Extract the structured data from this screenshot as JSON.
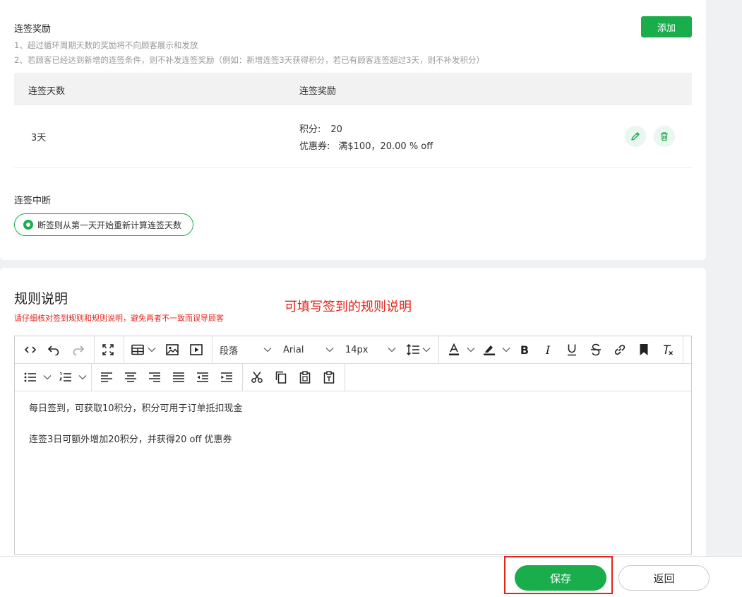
{
  "streak_reward": {
    "title": "连签奖励",
    "notes": [
      "1、超过循环周期天数的奖励将不向顾客展示和发放",
      "2、若顾客已经达到新增的连签条件，则不补发连签奖励（例如：新增连签3天获得积分，若已有顾客连签超过3天，则不补发积分）"
    ],
    "add_label": "添加",
    "table": {
      "headers": [
        "连签天数",
        "连签奖励"
      ],
      "rows": [
        {
          "days": "3天",
          "points_label": "积分:",
          "points_value": "20",
          "coupon_label": "优惠券:",
          "coupon_value": "满$100，20.00 % off"
        }
      ]
    },
    "break_title": "连签中断",
    "break_option": "断签则从第一天开始重新计算连签天数"
  },
  "rules": {
    "title": "规则说明",
    "warning": "请仔细核对签到规则和规则说明，避免两者不一致而误导顾客",
    "annotation": "可填写签到的规则说明",
    "toolbar": {
      "paragraph": "段落",
      "font": "Arial",
      "size": "14px"
    },
    "content": [
      "每日签到，可获取10积分，积分可用于订单抵扣现金",
      "连签3日可额外增加20积分，并获得20 off 优惠券"
    ]
  },
  "footer": {
    "save_label": "保存",
    "back_label": "返回"
  },
  "colors": {
    "primary": "#1aad4b",
    "warning": "#e1251b"
  }
}
